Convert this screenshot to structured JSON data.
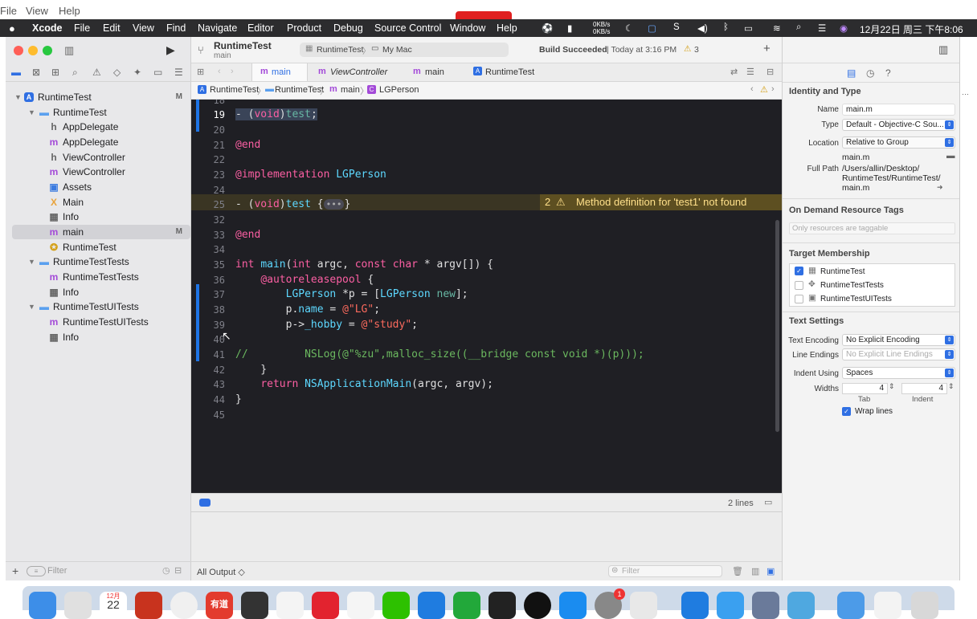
{
  "host_menu": [
    "File",
    "View",
    "Help"
  ],
  "menubar": {
    "apple": "",
    "app": "Xcode",
    "items": [
      "File",
      "Edit",
      "View",
      "Find",
      "Navigate",
      "Editor",
      "Product",
      "Debug",
      "Source Control",
      "Window",
      "Help"
    ],
    "net_up": "0KB/s",
    "net_down": "0KB/s",
    "clock": "12月22日 周三 下午8:06"
  },
  "toolbar": {
    "project": "RuntimeTest",
    "subtitle": "main",
    "scheme": "RuntimeTest",
    "destination": "My Mac",
    "build_status": "Build Succeeded",
    "build_time": "| Today at 3:16 PM",
    "warnings": "3"
  },
  "navigator": {
    "items": [
      {
        "label": "RuntimeTest",
        "icon": "A",
        "badge": "M"
      },
      {
        "label": "RuntimeTest",
        "icon": "",
        "badge": ""
      },
      {
        "label": "AppDelegate",
        "icon": "h",
        "badge": ""
      },
      {
        "label": "AppDelegate",
        "icon": "m",
        "badge": ""
      },
      {
        "label": "ViewController",
        "icon": "h",
        "badge": ""
      },
      {
        "label": "ViewController",
        "icon": "m",
        "badge": ""
      },
      {
        "label": "Assets",
        "icon": "",
        "badge": ""
      },
      {
        "label": "Main",
        "icon": "X",
        "badge": ""
      },
      {
        "label": "Info",
        "icon": "",
        "badge": ""
      },
      {
        "label": "main",
        "icon": "m",
        "badge": "M"
      },
      {
        "label": "RuntimeTest",
        "icon": "",
        "badge": ""
      },
      {
        "label": "RuntimeTestTests",
        "icon": "",
        "badge": ""
      },
      {
        "label": "RuntimeTestTests",
        "icon": "m",
        "badge": ""
      },
      {
        "label": "Info",
        "icon": "",
        "badge": ""
      },
      {
        "label": "RuntimeTestUITests",
        "icon": "",
        "badge": ""
      },
      {
        "label": "RuntimeTestUITests",
        "icon": "m",
        "badge": ""
      },
      {
        "label": "Info",
        "icon": "",
        "badge": ""
      }
    ],
    "filter_placeholder": "Filter"
  },
  "tabs": [
    {
      "label": "main",
      "icon": "m"
    },
    {
      "label": "ViewController",
      "icon": "m"
    },
    {
      "label": "main",
      "icon": "m"
    },
    {
      "label": "RuntimeTest",
      "icon": "A"
    }
  ],
  "jumpbar": [
    "RuntimeTest",
    "RuntimeTest",
    "main",
    "LGPerson"
  ],
  "jumpbar_icons": [
    "m",
    "C"
  ],
  "code": {
    "lines": [
      "18",
      "19",
      "20",
      "21",
      "22",
      "23",
      "24",
      "25",
      "32",
      "33",
      "34",
      "35",
      "36",
      "37",
      "38",
      "39",
      "40",
      "41",
      "42",
      "43",
      "44",
      "45"
    ],
    "warning_count": "2",
    "warning_text": "Method definition for 'test1' not found",
    "fold_placeholder": "•••"
  },
  "status": {
    "lines": "2 lines",
    "output_select": "All Output ◇",
    "filter_placeholder": "Filter"
  },
  "inspector": {
    "identity_title": "Identity and Type",
    "name_label": "Name",
    "name_value": "main.m",
    "type_label": "Type",
    "type_value": "Default - Objective-C Sou...",
    "location_label": "Location",
    "location_value": "Relative to Group",
    "location_file": "main.m",
    "fullpath_label": "Full Path",
    "fullpath_1": "/Users/allin/Desktop/",
    "fullpath_2": "RuntimeTest/RuntimeTest/",
    "fullpath_3": "main.m",
    "odr_title": "On Demand Resource Tags",
    "odr_placeholder": "Only resources are taggable",
    "membership_title": "Target Membership",
    "targets": [
      {
        "label": "RuntimeTest",
        "checked": true
      },
      {
        "label": "RuntimeTestTests",
        "checked": false
      },
      {
        "label": "RuntimeTestUITests",
        "checked": false
      }
    ],
    "text_title": "Text Settings",
    "encoding_label": "Text Encoding",
    "encoding_value": "No Explicit Encoding",
    "endings_label": "Line Endings",
    "endings_value": "No Explicit Line Endings",
    "indent_label": "Indent Using",
    "indent_value": "Spaces",
    "widths_label": "Widths",
    "tab_value": "4",
    "indent_width_value": "4",
    "tab_caption": "Tab",
    "indent_caption": "Indent",
    "wrap_label": "Wrap lines"
  },
  "dock": {
    "calendar_month": "12月",
    "calendar_day": "22",
    "youdao": "有道",
    "notif": "1"
  },
  "colors": {
    "accent": "#2f6fe3",
    "editor_bg": "#1f1f24",
    "keyword": "#fc5fa3",
    "string": "#fc6a5d",
    "warning": "#ffe08a"
  }
}
